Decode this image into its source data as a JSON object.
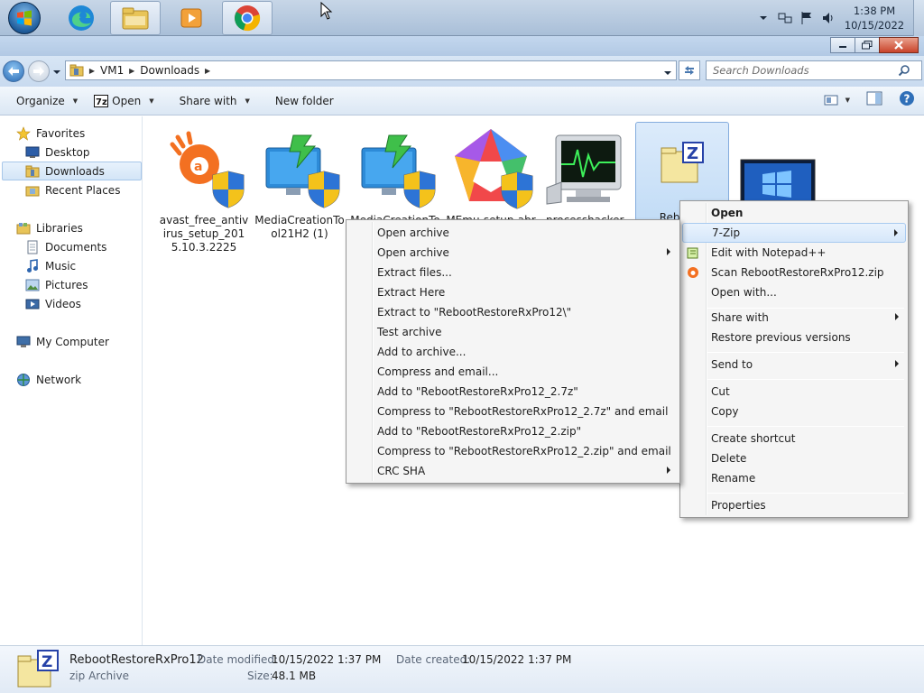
{
  "taskbar": {
    "apps": [
      {
        "name": "edge"
      },
      {
        "name": "explorer"
      },
      {
        "name": "media-player"
      },
      {
        "name": "chrome"
      }
    ],
    "clock": {
      "time": "1:38 PM",
      "date": "10/15/2022"
    }
  },
  "address": {
    "crumbs": [
      "VM1",
      "Downloads"
    ],
    "search_placeholder": "Search Downloads"
  },
  "toolbar": {
    "organize": "Organize",
    "open": "Open",
    "share_with": "Share with",
    "new_folder": "New folder"
  },
  "nav": {
    "favorites": "Favorites",
    "desktop": "Desktop",
    "downloads": "Downloads",
    "recent_places": "Recent Places",
    "libraries": "Libraries",
    "documents": "Documents",
    "music": "Music",
    "pictures": "Pictures",
    "videos": "Videos",
    "my_computer": "My Computer",
    "network": "Network"
  },
  "files": [
    {
      "name": "avast_free_antivirus_setup_2015.10.3.2225"
    },
    {
      "name": "MediaCreationTool21H2 (1)"
    },
    {
      "name": "MediaCreationTo"
    },
    {
      "name": "MEmu-setup-abr"
    },
    {
      "name": "processhacker-2."
    },
    {
      "name": "RebootR"
    },
    {
      "name": ""
    }
  ],
  "context_menu": {
    "items": [
      "Open",
      "7-Zip",
      "Edit with Notepad++",
      "Scan RebootRestoreRxPro12.zip",
      "Open with...",
      "Share with",
      "Restore previous versions",
      "Send to",
      "Cut",
      "Copy",
      "Create shortcut",
      "Delete",
      "Rename",
      "Properties"
    ]
  },
  "sevenzip_menu": {
    "items": [
      "Open archive",
      "Open archive",
      "Extract files...",
      "Extract Here",
      "Extract to \"RebootRestoreRxPro12\\\"",
      "Test archive",
      "Add to archive...",
      "Compress and email...",
      "Add to \"RebootRestoreRxPro12_2.7z\"",
      "Compress to \"RebootRestoreRxPro12_2.7z\" and email",
      "Add to \"RebootRestoreRxPro12_2.zip\"",
      "Compress to \"RebootRestoreRxPro12_2.zip\" and email",
      "CRC SHA"
    ]
  },
  "details": {
    "file_name": "RebootRestoreRxPro12",
    "file_type": "zip Archive",
    "date_modified_label": "Date modified:",
    "date_modified": "10/15/2022 1:37 PM",
    "size_label": "Size:",
    "size": "48.1 MB",
    "date_created_label": "Date created:",
    "date_created": "10/15/2022 1:37 PM"
  },
  "colors": {
    "selection": "#cce4f7",
    "menu_bg": "#f5f5f5",
    "taskbar": "#b7cbe1"
  }
}
